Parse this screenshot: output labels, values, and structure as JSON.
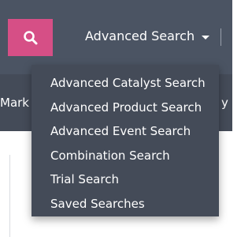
{
  "header": {
    "search_icon": "search-icon",
    "advanced_search_label": "Advanced Search",
    "caret_icon": "caret-down-icon"
  },
  "nav": {
    "partial_left_label": "Mark",
    "partial_right_label": "y"
  },
  "dropdown": {
    "items": [
      {
        "label": "Advanced Catalyst Search"
      },
      {
        "label": "Advanced Product Search"
      },
      {
        "label": "Advanced Event Search"
      },
      {
        "label": "Combination Search"
      },
      {
        "label": "Trial Search"
      },
      {
        "label": "Saved Searches"
      }
    ]
  },
  "colors": {
    "topbar": "#4b5463",
    "navbar": "#444b58",
    "search_button": "#d64f86",
    "dropdown": "#444b58"
  }
}
